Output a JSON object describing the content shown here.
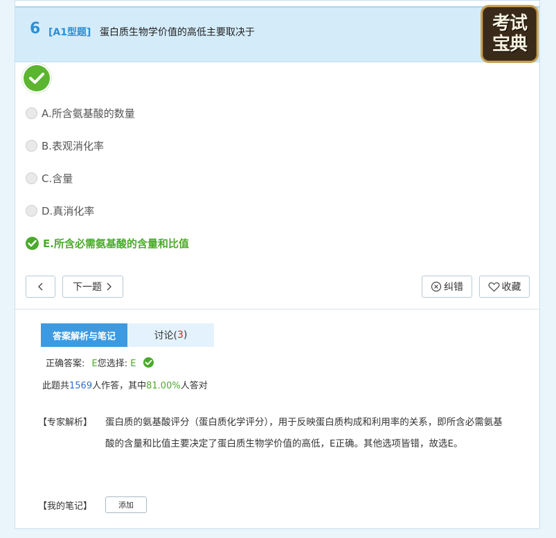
{
  "question": {
    "number": "6",
    "type": "[A1型题]",
    "text": "蛋白质生物学价值的高低主要取决于"
  },
  "logo": {
    "line1": "考试",
    "line2": "宝典"
  },
  "options": [
    {
      "label": "A.所含氨基酸的数量",
      "correct": false
    },
    {
      "label": "B.表观消化率",
      "correct": false
    },
    {
      "label": "C.含量",
      "correct": false
    },
    {
      "label": "D.真消化率",
      "correct": false
    },
    {
      "label": "E.所含必需氨基酸的含量和比值",
      "correct": true
    }
  ],
  "nav": {
    "prev_icon": "chevron-left-icon",
    "next_label": "下一题",
    "report_label": "纠错",
    "favorite_label": "收藏"
  },
  "tabs": {
    "analysis_label": "答案解析与笔记",
    "discussion_label": "讨论(",
    "discussion_count": "3",
    "discussion_close": ")"
  },
  "answer": {
    "correct_label": "正确答案:",
    "correct_value": "E",
    "your_label": "您选择:",
    "your_value": "E"
  },
  "stats": {
    "prefix": "此题共",
    "total": "1569",
    "middle": "人作答，其中",
    "rate": "81.00%",
    "suffix": "人答对"
  },
  "expert": {
    "label": "【专家解析】",
    "text": "蛋白质的氨基酸评分（蛋白质化学评分），用于反映蛋白质构成和利用率的关系，即所含必需氨基酸的含量和比值主要决定了蛋白质生物学价值的高低，E正确。其他选项皆错，故选E。"
  },
  "notes": {
    "label": "【我的笔记】",
    "add_label": "添加"
  },
  "colors": {
    "accent": "#2d8fd5",
    "correct": "#4aaa2a",
    "tab_active": "#3d9ae0",
    "header_bg": "#d4ecfa"
  }
}
